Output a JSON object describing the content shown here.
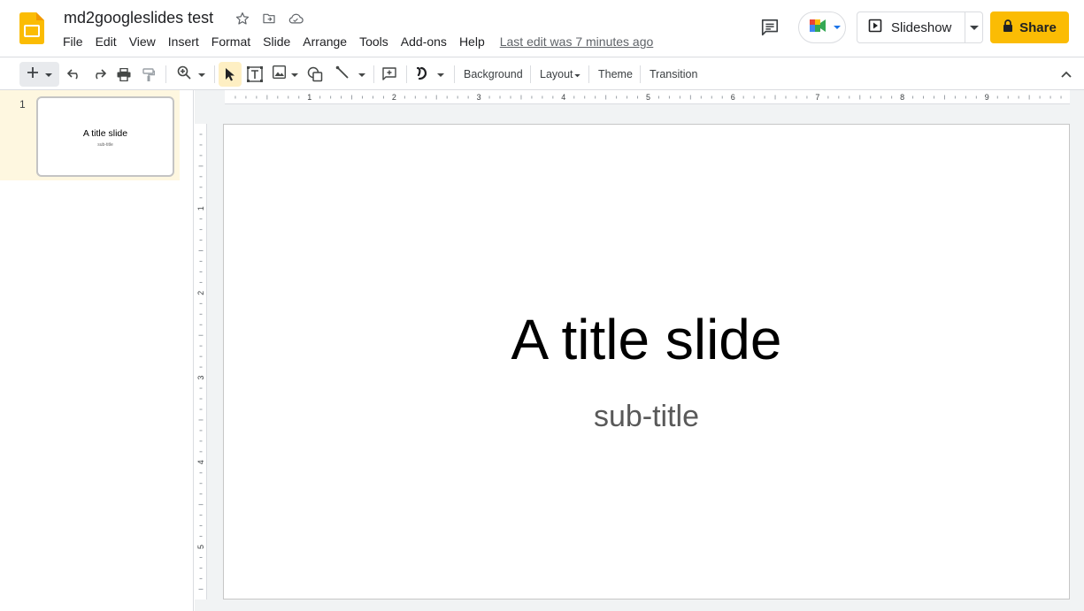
{
  "header": {
    "doc_title": "md2googleslides test",
    "menu": [
      "File",
      "Edit",
      "View",
      "Insert",
      "Format",
      "Slide",
      "Arrange",
      "Tools",
      "Add-ons",
      "Help"
    ],
    "last_edit": "Last edit was 7 minutes ago",
    "slideshow_label": "Slideshow",
    "share_label": "Share"
  },
  "toolbar": {
    "background_label": "Background",
    "layout_label": "Layout",
    "theme_label": "Theme",
    "transition_label": "Transition"
  },
  "filmstrip": {
    "slides": [
      {
        "number": "1",
        "title": "A title slide",
        "subtitle": "sub-title"
      }
    ]
  },
  "rulers": {
    "horizontal": [
      "1",
      "2",
      "3",
      "4",
      "5",
      "6",
      "7",
      "8",
      "9"
    ],
    "vertical": [
      "1",
      "2",
      "3",
      "4",
      "5"
    ]
  },
  "slide": {
    "title": "A title slide",
    "subtitle": "sub-title"
  },
  "colors": {
    "share_button": "#fbbc04",
    "selected_slide_bg": "#fef7e0",
    "selected_tool_bg": "#feefc3",
    "app_logo": "#fbbc04"
  },
  "icons": [
    "slides-logo",
    "star-icon",
    "move-to-folder-icon",
    "cloud-saved-icon",
    "comments-icon",
    "meet-icon",
    "slideshow-icon",
    "lock-icon"
  ]
}
